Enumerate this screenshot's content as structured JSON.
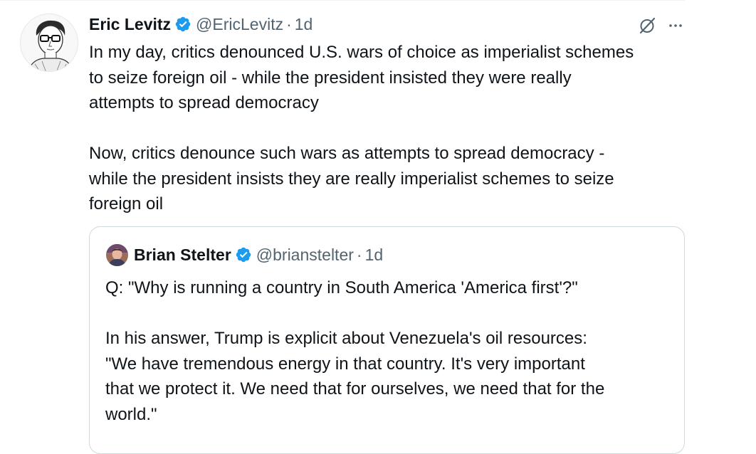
{
  "tweet": {
    "author_name": "Eric Levitz",
    "handle": "@EricLevitz",
    "separator": "·",
    "time": "1d",
    "text": "In my day, critics denounced U.S. wars of choice as imperialist schemes\nto seize foreign oil - while the president insisted they were really\nattempts to spread democracy\n\nNow, critics denounce such wars as attempts to spread democracy -\nwhile the president insists they are really imperialist schemes to seize\nforeign oil",
    "icons": {
      "avatar": "portrait-sketch-avatar",
      "verified": "verified-badge-icon",
      "grok": "grok-icon",
      "more": "more-options-icon"
    }
  },
  "quote": {
    "author_name": "Brian Stelter",
    "handle": "@brianstelter",
    "separator": "·",
    "time": "1d",
    "text": "Q: \"Why is running a country in South America 'America first'?\"\n\nIn his answer, Trump is explicit about Venezuela's oil resources:\n\"We have tremendous energy in that country. It's very important\nthat we protect it. We need that for ourselves, we need that for the\nworld.\""
  },
  "colors": {
    "text_primary": "#0f1419",
    "text_secondary": "#536471",
    "verified_blue": "#1d9bf0",
    "border": "#cfd9de"
  }
}
